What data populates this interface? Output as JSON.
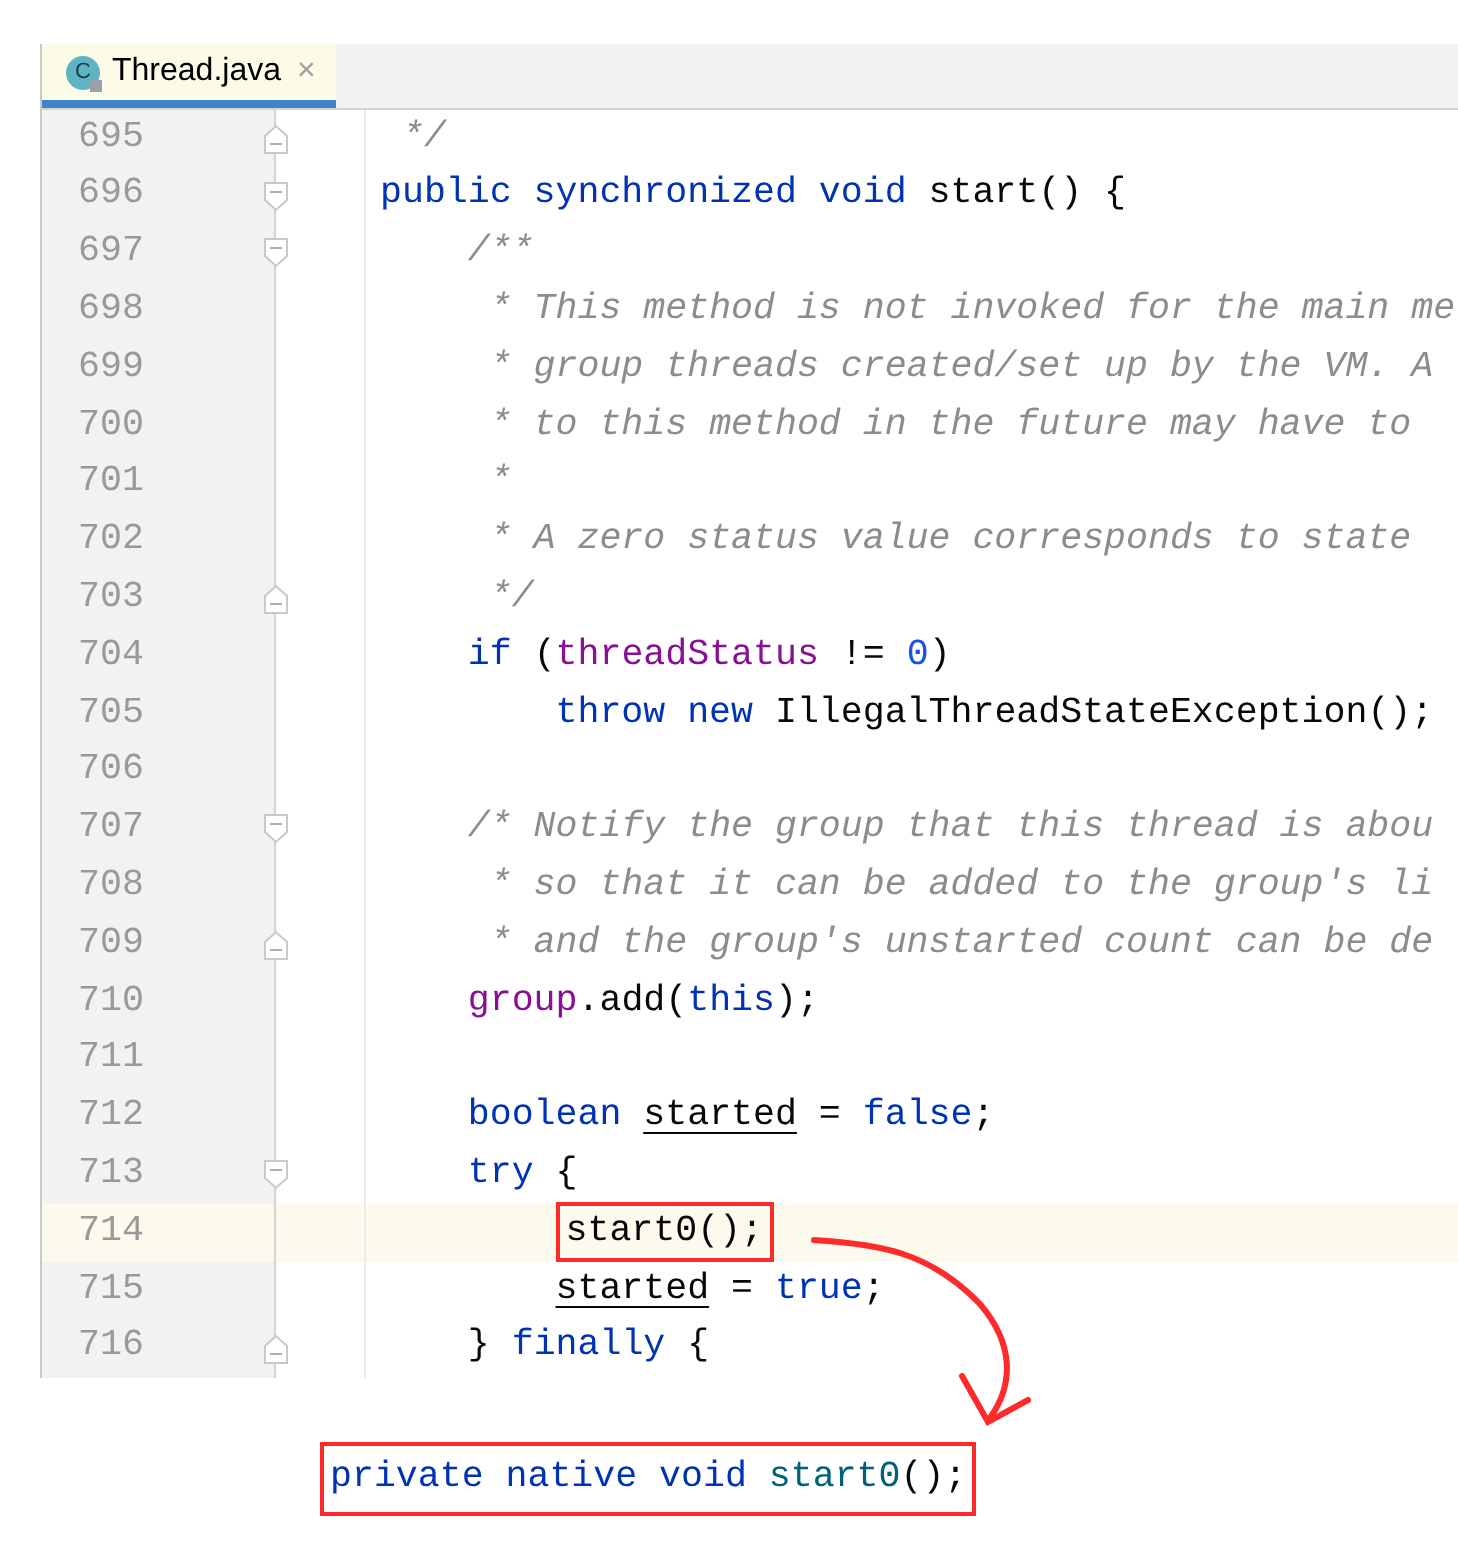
{
  "tab": {
    "icon_letter": "C",
    "label": "Thread.java",
    "close": "×",
    "selected": true
  },
  "lines": [
    {
      "number": "695",
      "fold_marker": {
        "kind": "end"
      },
      "current": false,
      "boxed": false,
      "tokens": [
        {
          "text": " */",
          "kind": "comment"
        }
      ]
    },
    {
      "number": "696",
      "fold_marker": {
        "kind": "start"
      },
      "current": false,
      "boxed": false,
      "tokens": [
        {
          "text": "public synchronized void",
          "kind": "keyword"
        },
        {
          "text": " start() {",
          "kind": "plain"
        }
      ]
    },
    {
      "number": "697",
      "fold_marker": {
        "kind": "start"
      },
      "current": false,
      "boxed": false,
      "tokens": [
        {
          "text": "    /**",
          "kind": "comment"
        }
      ]
    },
    {
      "number": "698",
      "current": false,
      "boxed": false,
      "tokens": [
        {
          "text": "     * This method is not invoked for the main me",
          "kind": "comment"
        }
      ]
    },
    {
      "number": "699",
      "current": false,
      "boxed": false,
      "tokens": [
        {
          "text": "     * group threads created/set up by the VM. A",
          "kind": "comment"
        }
      ]
    },
    {
      "number": "700",
      "current": false,
      "boxed": false,
      "tokens": [
        {
          "text": "     * to this method in the future may have to",
          "kind": "comment"
        }
      ]
    },
    {
      "number": "701",
      "current": false,
      "boxed": false,
      "tokens": [
        {
          "text": "     *",
          "kind": "comment"
        }
      ]
    },
    {
      "number": "702",
      "current": false,
      "boxed": false,
      "tokens": [
        {
          "text": "     * A zero status value corresponds to state",
          "kind": "comment"
        }
      ]
    },
    {
      "number": "703",
      "fold_marker": {
        "kind": "end"
      },
      "current": false,
      "boxed": false,
      "tokens": [
        {
          "text": "     */",
          "kind": "comment"
        }
      ]
    },
    {
      "number": "704",
      "current": false,
      "boxed": false,
      "tokens": [
        {
          "text": "    if",
          "kind": "keyword"
        },
        {
          "text": " (",
          "kind": "plain"
        },
        {
          "text": "threadStatus",
          "kind": "field"
        },
        {
          "text": " != ",
          "kind": "plain"
        },
        {
          "text": "0",
          "kind": "number"
        },
        {
          "text": ")",
          "kind": "plain"
        }
      ]
    },
    {
      "number": "705",
      "current": false,
      "boxed": false,
      "tokens": [
        {
          "text": "        throw new",
          "kind": "keyword"
        },
        {
          "text": " IllegalThreadStateException();",
          "kind": "plain"
        }
      ]
    },
    {
      "number": "706",
      "current": false
    },
    {
      "number": "707",
      "fold_marker": {
        "kind": "start"
      },
      "current": false,
      "boxed": false,
      "tokens": [
        {
          "text": "    /* Notify the group that this thread is abou",
          "kind": "comment"
        }
      ]
    },
    {
      "number": "708",
      "current": false,
      "boxed": false,
      "tokens": [
        {
          "text": "     * so that it can be added to the group's li",
          "kind": "comment"
        }
      ]
    },
    {
      "number": "709",
      "fold_marker": {
        "kind": "end"
      },
      "current": false,
      "boxed": false,
      "tokens": [
        {
          "text": "     * and the group's unstarted count can be de",
          "kind": "comment"
        }
      ]
    },
    {
      "number": "710",
      "current": false,
      "boxed": false,
      "tokens": [
        {
          "text": "    group",
          "kind": "field"
        },
        {
          "text": ".add(",
          "kind": "plain"
        },
        {
          "text": "this",
          "kind": "keyword"
        },
        {
          "text": ");",
          "kind": "plain"
        }
      ]
    },
    {
      "number": "711",
      "current": false
    },
    {
      "number": "712",
      "current": false,
      "boxed": false,
      "tokens": [
        {
          "text": "    boolean ",
          "kind": "keyword"
        },
        {
          "text": "started",
          "kind": "reassigned"
        },
        {
          "text": " = ",
          "kind": "plain"
        },
        {
          "text": "false",
          "kind": "keyword"
        },
        {
          "text": ";",
          "kind": "plain"
        }
      ]
    },
    {
      "number": "713",
      "fold_marker": {
        "kind": "start"
      },
      "current": false,
      "boxed": false,
      "tokens": [
        {
          "text": "    try",
          "kind": "keyword"
        },
        {
          "text": " {",
          "kind": "plain"
        }
      ]
    },
    {
      "number": "714",
      "current": true,
      "boxed": true,
      "tokens": [
        {
          "text": "        start0();",
          "kind": "plain"
        }
      ]
    },
    {
      "number": "715",
      "current": false,
      "boxed": false,
      "tokens": [
        {
          "text": "        started",
          "kind": "reassigned"
        },
        {
          "text": " = ",
          "kind": "plain"
        },
        {
          "text": "true",
          "kind": "keyword"
        },
        {
          "text": ";",
          "kind": "plain"
        }
      ]
    },
    {
      "number": "716",
      "fold_marker": {
        "kind": "end"
      },
      "current": false,
      "boxed": false,
      "tokens": [
        {
          "text": "    } ",
          "kind": "plain"
        },
        {
          "text": "finally",
          "kind": "keyword"
        },
        {
          "text": " {",
          "kind": "plain"
        }
      ]
    }
  ],
  "snippet": {
    "tokens": [
      {
        "text": "private native void ",
        "kind": "keyword"
      },
      {
        "text": "start0",
        "kind": "method"
      },
      {
        "text": "();",
        "kind": "plain"
      }
    ]
  }
}
